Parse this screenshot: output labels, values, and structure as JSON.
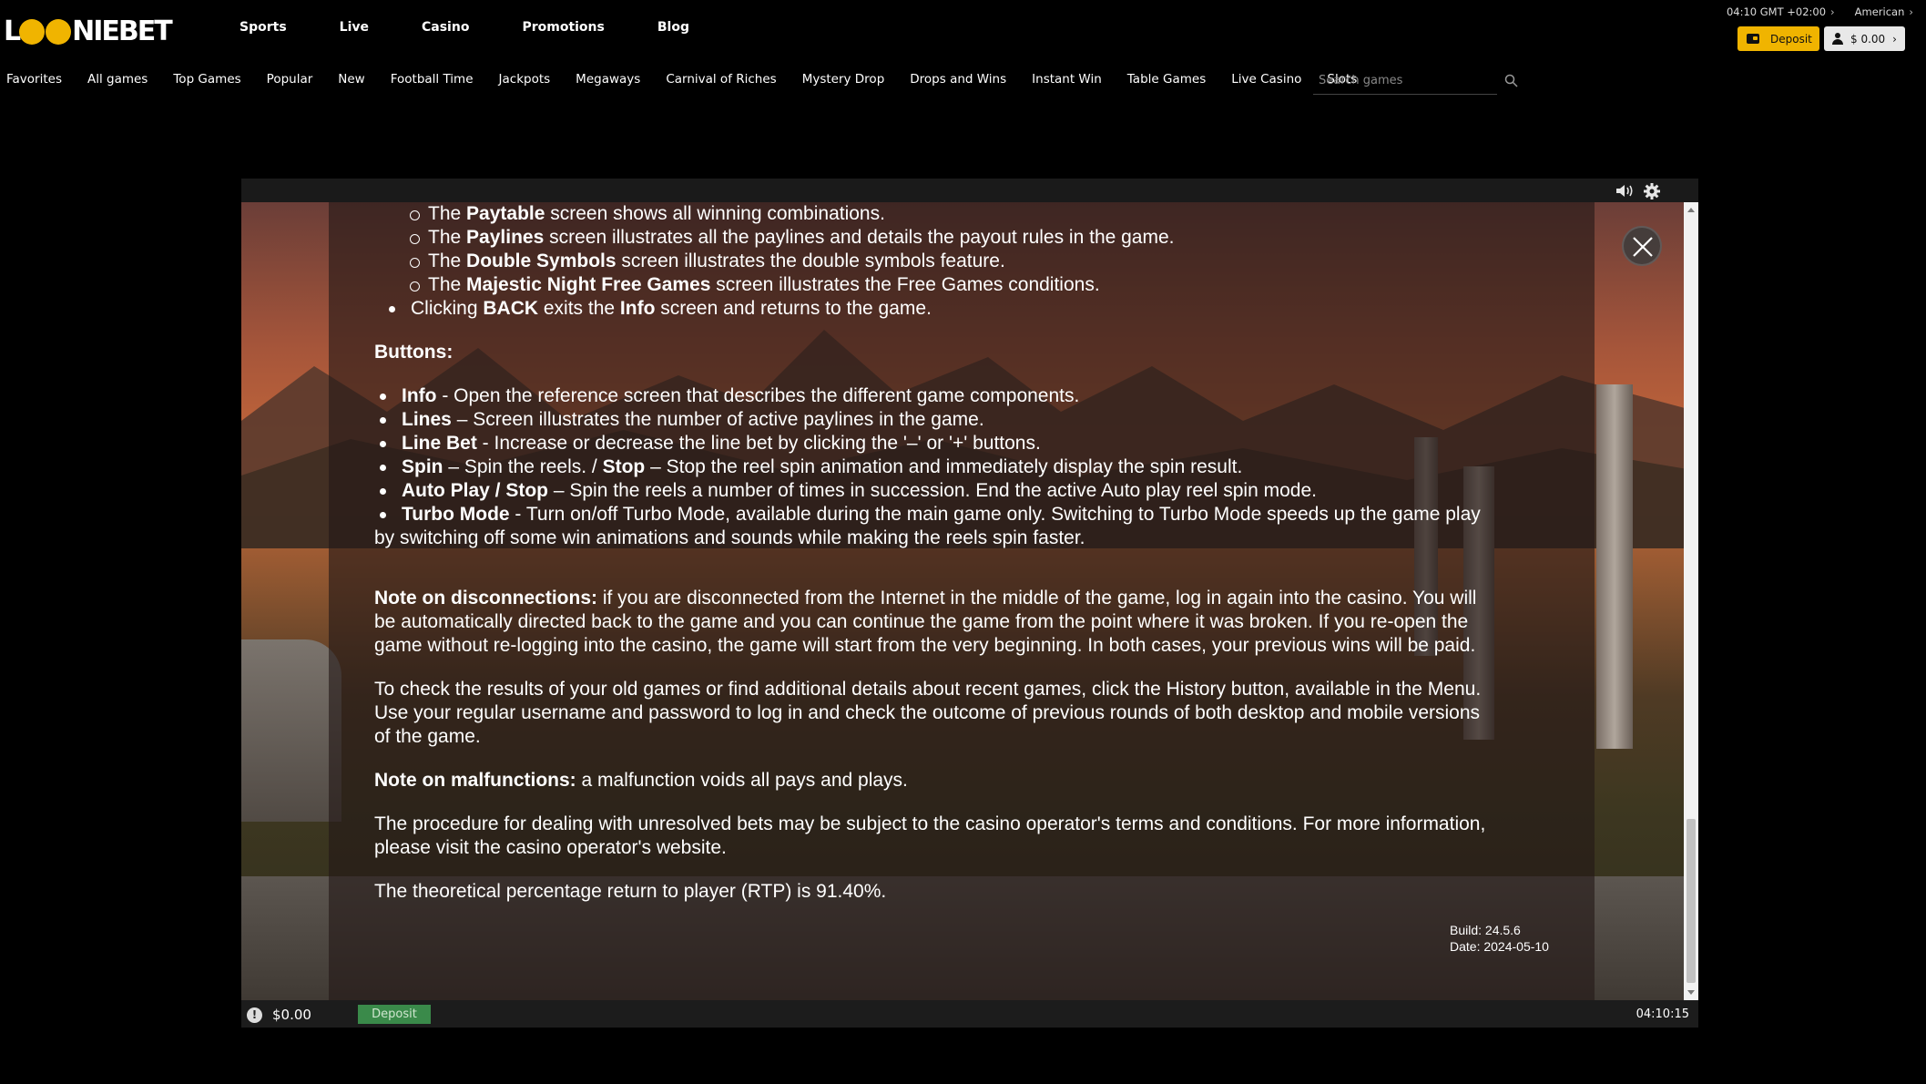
{
  "brand": {
    "logo_pre": "L",
    "logo_oo": "OO",
    "logo_post": "NIE",
    "logo_bet": "BET"
  },
  "mainnav": [
    "Sports",
    "Live",
    "Casino",
    "Promotions",
    "Blog"
  ],
  "topright": {
    "time": "04:10 GMT +02:00",
    "odds_format": "American"
  },
  "header_buttons": {
    "deposit": "Deposit",
    "balance": "$ 0.00"
  },
  "catnav": [
    "Favorites",
    "All games",
    "Top Games",
    "Popular",
    "New",
    "Football Time",
    "Jackpots",
    "Megaways",
    "Carnival of Riches",
    "Mystery Drop",
    "Drops and Wins",
    "Instant Win",
    "Table Games",
    "Live Casino",
    "Slots"
  ],
  "search": {
    "placeholder": "Search games"
  },
  "info": {
    "sub_bullets": [
      [
        "The ",
        "Paytable",
        " screen shows all winning combinations."
      ],
      [
        "The ",
        "Paylines",
        " screen illustrates all the paylines and details the payout rules in the game."
      ],
      [
        "The ",
        "Double Symbols",
        " screen illustrates the double symbols feature."
      ],
      [
        "The ",
        "Majestic Night Free Games",
        " screen illustrates the Free Games conditions."
      ]
    ],
    "back_line": [
      "Clicking ",
      "BACK",
      " exits the ",
      "Info",
      " screen and returns to the game."
    ],
    "buttons_heading": "Buttons:",
    "buttons": [
      [
        "Info",
        " - Open the reference screen that describes the different game components."
      ],
      [
        "Lines",
        " – Screen illustrates the number of active paylines in the game."
      ],
      [
        "Line Bet",
        " - Increase or decrease the line bet by clicking the '–' or '+' buttons."
      ],
      [
        "Spin",
        " – Spin the reels. / ",
        "Stop",
        " – Stop the reel spin animation and immediately display the spin result."
      ],
      [
        "Auto Play / Stop",
        " – Spin the reels a number of times in succession. End the active Auto play reel spin mode."
      ],
      [
        "Turbo Mode",
        " - Turn on/off Turbo Mode, available during the main game only. Switching to Turbo Mode speeds up the game play"
      ]
    ],
    "turbo_cont": "by switching off some win animations and sounds while making the reels spin faster.",
    "disconnect_label": "Note on disconnections:",
    "disconnect_lines": [
      " if you are disconnected from the Internet in the middle of the game, log in again into the casino. You will",
      "be automatically directed back to the game and you can continue the game from the point where it was broken. If you re-open the",
      "game without re-logging into the casino, the game will start from the very beginning. In both cases, your previous wins will be paid."
    ],
    "history_lines": [
      "To check the results of your old games or find additional details about recent games, click the History button, available in the Menu.",
      "Use your regular username and password to log in and check the outcome of previous rounds of both desktop and mobile versions",
      "of the game."
    ],
    "malfunction_label": "Note on malfunctions:",
    "malfunction_text": " a malfunction voids all pays and plays.",
    "procedure_lines": [
      "The procedure for dealing with unresolved bets may be subject to the casino operator's terms and conditions. For more information,",
      "please visit the casino operator's website."
    ],
    "rtp": "The theoretical percentage return to player (RTP) is 91.40%.",
    "build": "Build: 24.5.6",
    "date": "Date: 2024-05-10"
  },
  "gamebar": {
    "info_glyph": "!",
    "balance": "$0.00",
    "deposit": "Deposit",
    "clock": "04:10:15"
  },
  "colors": {
    "accent": "#f0b400",
    "game_deposit": "#3a8a4a"
  }
}
